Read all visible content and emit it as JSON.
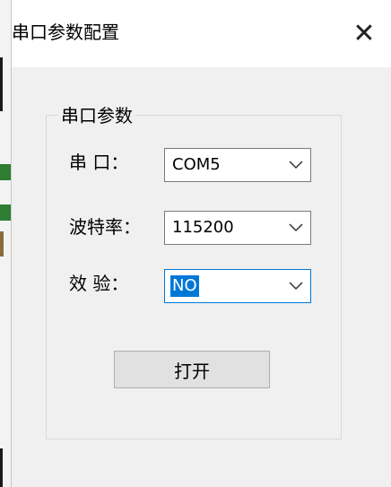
{
  "window": {
    "title": "串口参数配置",
    "close_glyph": "✕"
  },
  "group": {
    "title": "串口参数"
  },
  "fields": [
    {
      "label": "串  口：",
      "value": "COM5"
    },
    {
      "label": "波特率：",
      "value": "115200"
    },
    {
      "label": "效  验：",
      "value": "NO"
    }
  ],
  "actions": {
    "open_label": "打开"
  },
  "colors": {
    "accent": "#0078d7",
    "dialog_bg": "#f0f0f0"
  }
}
